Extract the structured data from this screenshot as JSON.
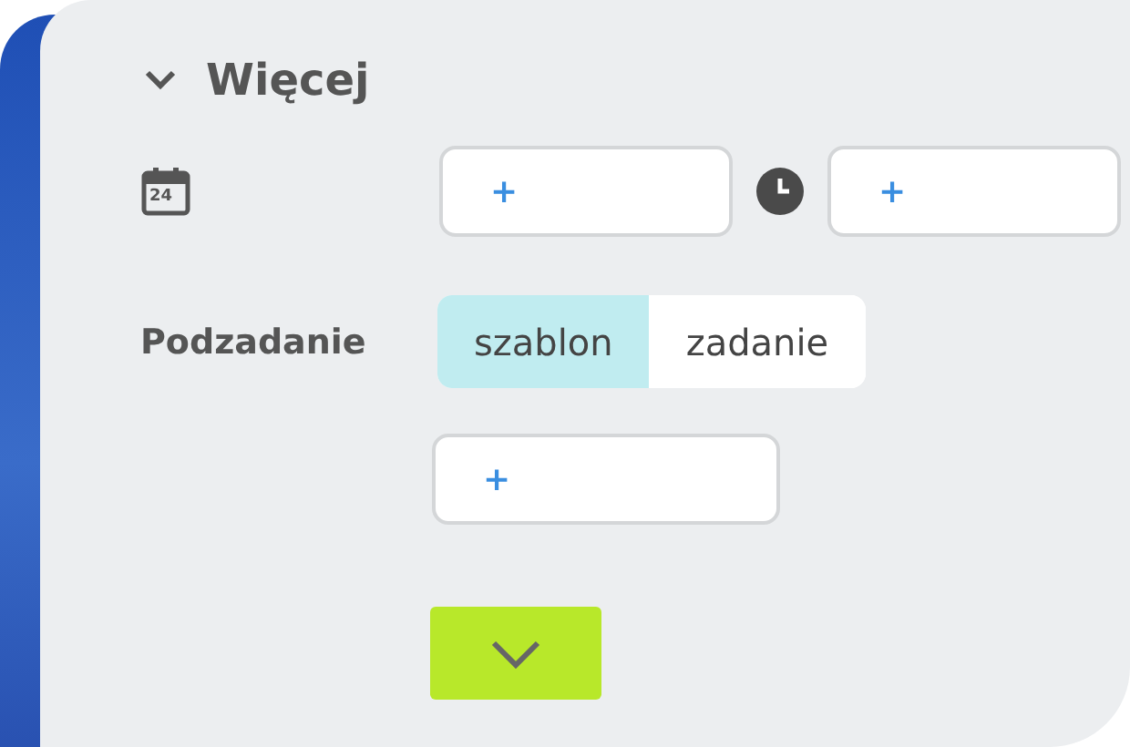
{
  "section": {
    "title": "Więcej",
    "expanded": true
  },
  "date_icon_day": "24",
  "date_field": {
    "value": "+"
  },
  "time_field": {
    "value": "+"
  },
  "subtask": {
    "label": "Podzadanie",
    "options": [
      {
        "label": "szablon",
        "selected": true
      },
      {
        "label": "zadanie",
        "selected": false
      }
    ]
  },
  "subtask_field": {
    "value": "+"
  }
}
